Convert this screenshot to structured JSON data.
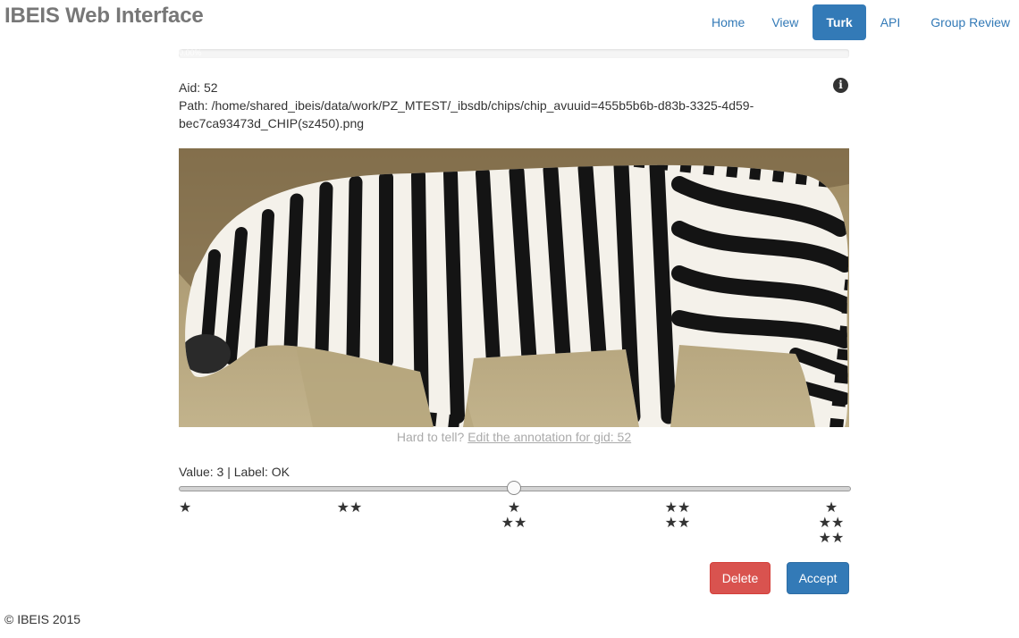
{
  "brand": "IBEIS Web Interface",
  "nav": [
    {
      "label": "Home"
    },
    {
      "label": "View"
    },
    {
      "label": "Turk",
      "active": true
    },
    {
      "label": "API"
    },
    {
      "label": "Group Review"
    }
  ],
  "progress": {
    "label": "0.00%",
    "value": 0
  },
  "info": {
    "aid_line": "Aid: 52",
    "path_line_1": "Path: /home/shared_ibeis/data/work/PZ_MTEST/_ibsdb/chips/chip_avuuid=455b5b6b-d83b-3325-4d59-",
    "path_line_2": "bec7ca93473d_CHIP(sz450).png",
    "info_icon": "info-circle-icon"
  },
  "chip_image": {
    "subject": "zebra"
  },
  "hint": {
    "prefix": "Hard to tell?",
    "link": "Edit the annotation for gid: 52"
  },
  "quality": {
    "value_text": "Value: 3 | Label: OK",
    "value": 3,
    "min": 1,
    "max": 5,
    "star_icon": "star-icon",
    "levels": [
      {
        "rows": [
          "★"
        ]
      },
      {
        "rows": [
          "★★"
        ]
      },
      {
        "rows": [
          "★",
          "★★"
        ]
      },
      {
        "rows": [
          "★★",
          "★★"
        ]
      },
      {
        "rows": [
          "★",
          "★★",
          "★★"
        ]
      }
    ]
  },
  "buttons": {
    "delete": "Delete",
    "accept": "Accept"
  },
  "colors": {
    "primary": "#337ab7",
    "danger": "#d9534f",
    "muted_text": "#aaaaaa"
  },
  "footer": "© IBEIS 2015"
}
